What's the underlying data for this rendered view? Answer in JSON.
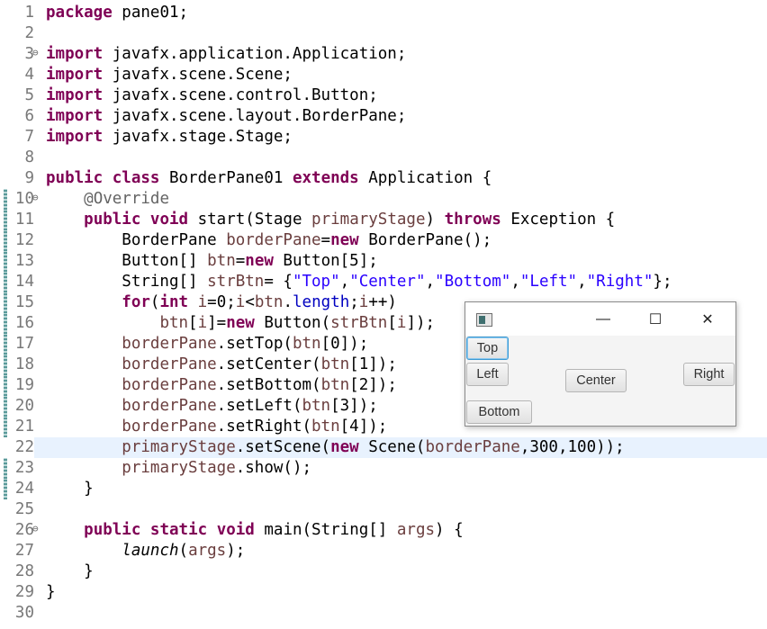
{
  "editor": {
    "lines": [
      {
        "n": "1",
        "html": "<span class='kw'>package</span> pane01;"
      },
      {
        "n": "2",
        "html": ""
      },
      {
        "n": "3",
        "fold": "⊖",
        "html": "<span class='kw'>import</span> javafx.application.Application;"
      },
      {
        "n": "4",
        "html": "<span class='kw'>import</span> javafx.scene.Scene;"
      },
      {
        "n": "5",
        "html": "<span class='kw'>import</span> javafx.scene.control.Button;"
      },
      {
        "n": "6",
        "html": "<span class='kw'>import</span> javafx.scene.layout.BorderPane;"
      },
      {
        "n": "7",
        "html": "<span class='kw'>import</span> javafx.stage.Stage;"
      },
      {
        "n": "8",
        "html": ""
      },
      {
        "n": "9",
        "html": "<span class='kw'>public</span> <span class='kw'>class</span> BorderPane01 <span class='kw'>extends</span> Application {"
      },
      {
        "n": "10",
        "fold": "⊖",
        "mark": true,
        "html": "    <span class='ann'>@Override</span>"
      },
      {
        "n": "11",
        "mark": true,
        "html": "    <span class='kw'>public</span> <span class='kw'>void</span> start(Stage <span class='loc'>primaryStage</span>) <span class='kw'>throws</span> Exception {"
      },
      {
        "n": "12",
        "mark": true,
        "html": "        BorderPane <span class='loc'>borderPane</span>=<span class='kw'>new</span> BorderPane();"
      },
      {
        "n": "13",
        "mark": true,
        "html": "        Button[] <span class='loc'>btn</span>=<span class='kw'>new</span> Button[5];"
      },
      {
        "n": "14",
        "mark": true,
        "html": "        String[] <span class='loc'>strBtn</span>= {<span class='str'>\"Top\"</span>,<span class='str'>\"Center\"</span>,<span class='str'>\"Bottom\"</span>,<span class='str'>\"Left\"</span>,<span class='str'>\"Right\"</span>};"
      },
      {
        "n": "15",
        "mark": true,
        "html": "        <span class='kw'>for</span>(<span class='kw'>int</span> <span class='loc'>i</span>=0;<span class='loc'>i</span>&lt;<span class='loc'>btn</span>.<span class='fld'>length</span>;<span class='loc'>i</span>++)"
      },
      {
        "n": "16",
        "mark": true,
        "html": "            <span class='loc'>btn</span>[<span class='loc'>i</span>]=<span class='kw'>new</span> Button(<span class='loc'>strBtn</span>[<span class='loc'>i</span>]);"
      },
      {
        "n": "17",
        "mark": true,
        "html": "        <span class='loc'>borderPane</span>.setTop(<span class='loc'>btn</span>[0]);"
      },
      {
        "n": "18",
        "mark": true,
        "html": "        <span class='loc'>borderPane</span>.setCenter(<span class='loc'>btn</span>[1]);"
      },
      {
        "n": "19",
        "mark": true,
        "html": "        <span class='loc'>borderPane</span>.setBottom(<span class='loc'>btn</span>[2]);"
      },
      {
        "n": "20",
        "mark": true,
        "html": "        <span class='loc'>borderPane</span>.setLeft(<span class='loc'>btn</span>[3]);"
      },
      {
        "n": "21",
        "mark": true,
        "html": "        <span class='loc'>borderPane</span>.setRight(<span class='loc'>btn</span>[4]);"
      },
      {
        "n": "22",
        "mark": true,
        "current": true,
        "html": "        <span class='loc'>primaryStage</span>.setScene(<span class='kw'>new</span> Scene(<span class='loc'>borderPane</span>,300,100));"
      },
      {
        "n": "23",
        "mark": true,
        "html": "        <span class='loc'>primaryStage</span>.show();"
      },
      {
        "n": "24",
        "mark": true,
        "html": "    }"
      },
      {
        "n": "25",
        "html": ""
      },
      {
        "n": "26",
        "fold": "⊖",
        "html": "    <span class='kw'>public</span> <span class='kw'>static</span> <span class='kw'>void</span> main(String[] <span class='loc'>args</span>) {"
      },
      {
        "n": "27",
        "html": "        <span class='ital'>launch</span>(<span class='loc'>args</span>);"
      },
      {
        "n": "28",
        "html": "    }"
      },
      {
        "n": "29",
        "html": "}"
      },
      {
        "n": "30",
        "html": ""
      }
    ]
  },
  "fx_window": {
    "minimize_glyph": "—",
    "maximize_glyph": "☐",
    "close_glyph": "✕",
    "buttons": {
      "top": "Top",
      "left": "Left",
      "center": "Center",
      "right": "Right",
      "bottom": "Bottom"
    }
  },
  "colors": {
    "keyword": "#7f0055",
    "string": "#2a00ff",
    "annotation": "#646464",
    "field": "#0000c0",
    "local": "#6a3e3e",
    "current_line": "#e8f2fe"
  }
}
